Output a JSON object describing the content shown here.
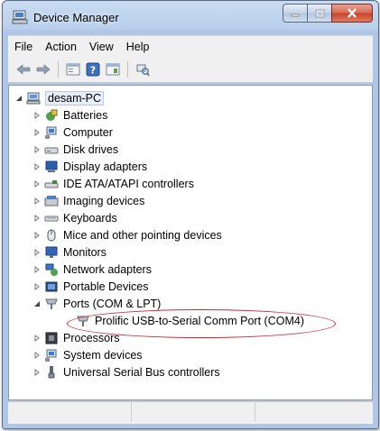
{
  "window": {
    "title": "Device Manager",
    "title_icon": "device-manager-icon"
  },
  "caption_buttons": [
    {
      "name": "minimize-button",
      "icon": "minimize-icon"
    },
    {
      "name": "maximize-button",
      "icon": "maximize-icon"
    },
    {
      "name": "close-button",
      "icon": "close-icon"
    }
  ],
  "menubar": {
    "items": [
      "File",
      "Action",
      "View",
      "Help"
    ]
  },
  "toolbar": {
    "buttons": [
      "back-arrow-icon",
      "forward-arrow-icon",
      "properties-icon",
      "help-icon",
      "update-driver-icon",
      "scan-hardware-icon"
    ]
  },
  "tree": {
    "root": {
      "label": "desam-PC",
      "icon": "computer-icon",
      "expanded": true
    },
    "categories": [
      {
        "label": "Batteries",
        "icon": "battery-icon"
      },
      {
        "label": "Computer",
        "icon": "computer-icon"
      },
      {
        "label": "Disk drives",
        "icon": "disk-drive-icon"
      },
      {
        "label": "Display adapters",
        "icon": "display-adapter-icon"
      },
      {
        "label": "IDE ATA/ATAPI controllers",
        "icon": "ide-controller-icon"
      },
      {
        "label": "Imaging devices",
        "icon": "imaging-device-icon"
      },
      {
        "label": "Keyboards",
        "icon": "keyboard-icon"
      },
      {
        "label": "Mice and other pointing devices",
        "icon": "mouse-icon"
      },
      {
        "label": "Monitors",
        "icon": "monitor-icon"
      },
      {
        "label": "Network adapters",
        "icon": "network-adapter-icon"
      },
      {
        "label": "Portable Devices",
        "icon": "portable-device-icon"
      },
      {
        "label": "Ports (COM & LPT)",
        "icon": "port-icon",
        "expanded": true
      },
      {
        "label": "Prolific USB-to-Serial Comm Port (COM4)",
        "icon": "port-icon",
        "child": true
      },
      {
        "label": "Processors",
        "icon": "processor-icon"
      },
      {
        "label": "System devices",
        "icon": "system-device-icon"
      },
      {
        "label": "Universal Serial Bus controllers",
        "icon": "usb-icon"
      }
    ]
  },
  "annotation": {
    "color": "#d0272e",
    "target": "Prolific USB-to-Serial Comm Port (COM4)"
  }
}
